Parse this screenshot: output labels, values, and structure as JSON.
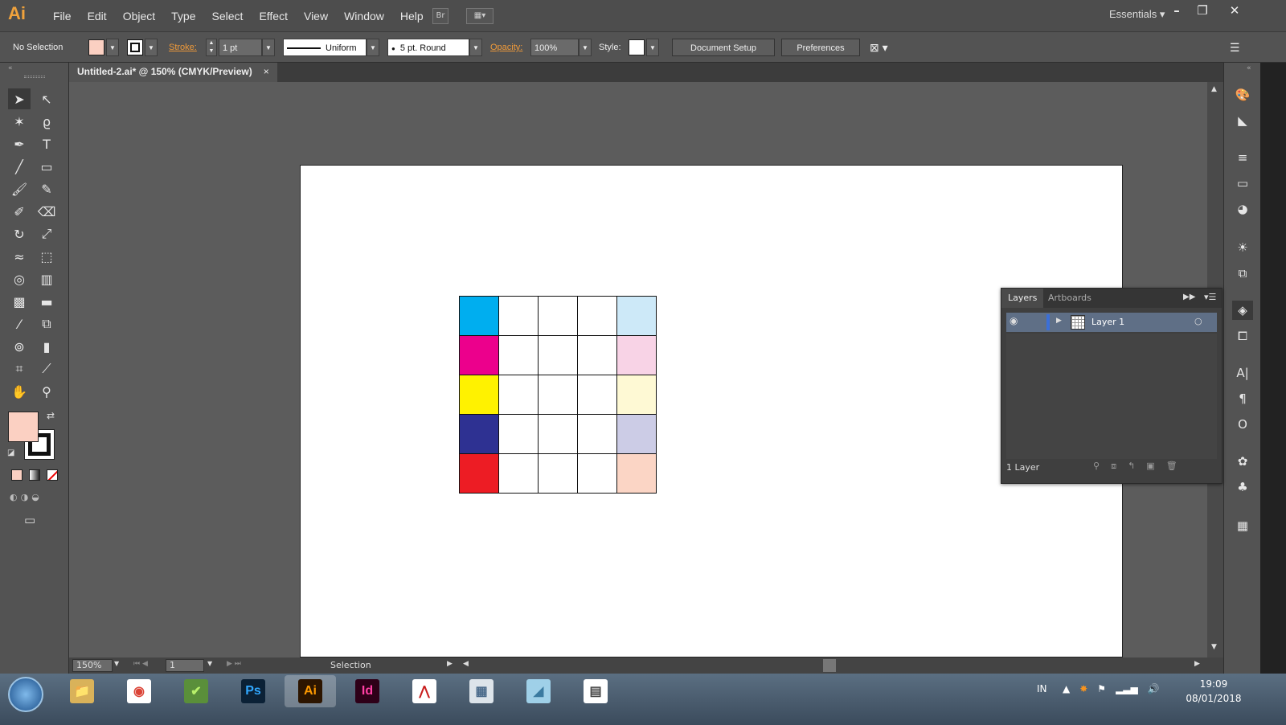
{
  "app": {
    "logo": "Ai",
    "menu": [
      "File",
      "Edit",
      "Object",
      "Type",
      "Select",
      "Effect",
      "View",
      "Window",
      "Help"
    ],
    "bridge": "Br",
    "workspace": "Essentials"
  },
  "control": {
    "selection": "No Selection",
    "fill_color": "#fbd0c2",
    "stroke_label": "Stroke:",
    "stroke_weight": "1 pt",
    "profile": "Uniform",
    "brush": "5 pt. Round",
    "opacity_label": "Opacity:",
    "opacity": "100%",
    "style_label": "Style:",
    "document_setup": "Document Setup",
    "preferences": "Preferences"
  },
  "doc": {
    "tab_title": "Untitled-2.ai* @ 150% (CMYK/Preview)",
    "close": "×"
  },
  "grid": {
    "rows": [
      [
        "#00aeef",
        "#fff",
        "#fff",
        "#fff",
        "#cde9f8"
      ],
      [
        "#ec008c",
        "#fff",
        "#fff",
        "#fff",
        "#f8d3e6"
      ],
      [
        "#fff200",
        "#fff",
        "#fff",
        "#fff",
        "#fef9d4"
      ],
      [
        "#2e3192",
        "#fff",
        "#fff",
        "#fff",
        "#cccce6"
      ],
      [
        "#ed1c24",
        "#fff",
        "#fff",
        "#fff",
        "#fbd5c5"
      ]
    ]
  },
  "status": {
    "zoom": "150%",
    "artboard": "1",
    "tool": "Selection"
  },
  "layers": {
    "tabs": [
      "Layers",
      "Artboards"
    ],
    "layer_name": "Layer 1",
    "count": "1 Layer"
  },
  "taskbar": {
    "lang": "IN",
    "time": "19:09",
    "date": "08/01/2018",
    "apps": [
      {
        "label": "📁",
        "bg": "#d9b25a",
        "fg": "#5a3a00"
      },
      {
        "label": "◉",
        "bg": "#ffffff",
        "fg": "#db4437"
      },
      {
        "label": "✔",
        "bg": "#5a8f3a",
        "fg": "#b8f06a"
      },
      {
        "label": "Ps",
        "bg": "#0b2136",
        "fg": "#31a8ff"
      },
      {
        "label": "Ai",
        "bg": "#2d1500",
        "fg": "#ff9a00"
      },
      {
        "label": "Id",
        "bg": "#2e0018",
        "fg": "#ff3fa4"
      },
      {
        "label": "⋀",
        "bg": "#ffffff",
        "fg": "#c81e1e"
      },
      {
        "label": "▦",
        "bg": "#dde4ea",
        "fg": "#4a6a8a"
      },
      {
        "label": "◢",
        "bg": "#9fd0e8",
        "fg": "#3a7aa0"
      },
      {
        "label": "▤",
        "bg": "#ffffff",
        "fg": "#444"
      }
    ]
  }
}
